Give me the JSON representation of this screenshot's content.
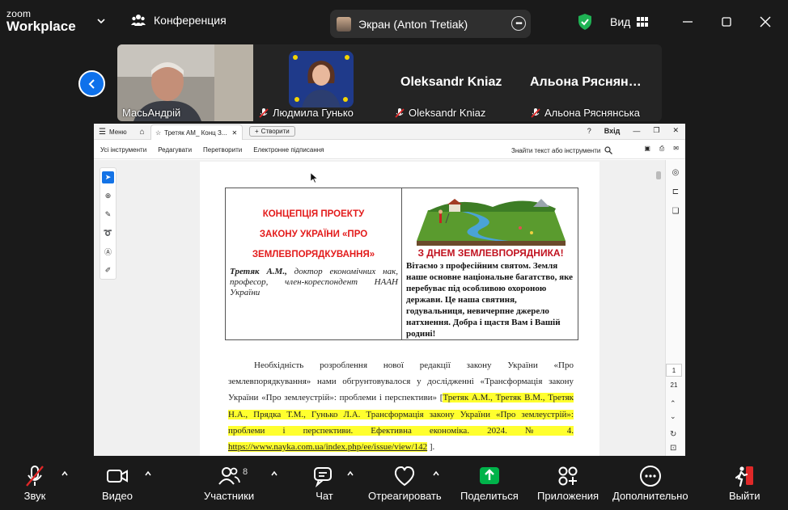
{
  "app": {
    "brand_top": "zoom",
    "brand_bottom": "Workplace"
  },
  "topbar": {
    "conference_label": "Конференция",
    "share_label": "Экран (Anton Tretiak)",
    "view_label": "Вид"
  },
  "participants": [
    {
      "name": "МасьАндрій",
      "muted": false
    },
    {
      "name": "Людмила Гунько",
      "muted": true
    },
    {
      "name": "Oleksandr Kniaz",
      "big_name": "Oleksandr Kniaz",
      "muted": true
    },
    {
      "name": "Альона Ряснянська",
      "big_name": "Альона Ряснян…",
      "muted": true
    }
  ],
  "acrobat": {
    "menu_label": "Меню",
    "tab_title": "Третяк АМ_ Конц З...",
    "create_label": "Створити",
    "login_label": "Вхід",
    "toolbar_items": [
      "Усі інструменти",
      "Редагувати",
      "Перетворити",
      "Електронне підписання"
    ],
    "find_label": "Знайти текст або інструменти",
    "page_current": "1",
    "page_total": "21"
  },
  "document": {
    "title_lines": [
      "КОНЦЕПЦІЯ ПРОЕКТУ",
      "ЗАКОНУ УКРАЇНИ «ПРО",
      "ЗЕМЛЕВПОРЯДКУВАННЯ»"
    ],
    "author_name": "Третяк А.М.,",
    "author_rest": " доктор економічних нак, професор, член-кореспондент НААН України",
    "congrats_title": "З ДНЕМ ЗЕМЛЕВПОРЯДНИКА!",
    "congrats_text": "Вітаємо з професійним святом. Земля наше основне національне багатство, яке перебуває під особливою охороною держави. Це наша святиня, годувальниця, невичерпне джерело натхнення. Добра і щастя Вам і Вашій родині!",
    "para_plain": "Необхідність розроблення нової редакції закону України «Про землевпорядкування» нами обгрунтовувалося у дослідженні «Трансформація закону України «Про землеустрій»: проблеми і перспективи» [",
    "para_highlight": "Третяк А.М., Третяк В.М., Третяк Н.А., Прядка Т.М., Гунько Л.А. Трансформація закону України «Про землеустрій»: проблеми і перспективи. Ефективна економіка. 2024. № 4.",
    "para_link": "https://www.nayka.com.ua/index.php/ee/issue/view/142",
    "para_end": " ]."
  },
  "bottombar": {
    "audio": "Звук",
    "video": "Видео",
    "participants": "Участники",
    "participants_count": "8",
    "chat": "Чат",
    "react": "Отреагировать",
    "share": "Поделиться",
    "apps": "Приложения",
    "more": "Дополнительно",
    "leave": "Выйти"
  },
  "colors": {
    "accent": "#0e71eb",
    "share_green": "#00b34a",
    "leave_red": "#e02828",
    "doc_red": "#e31b1b",
    "highlight": "#ffff2e"
  }
}
